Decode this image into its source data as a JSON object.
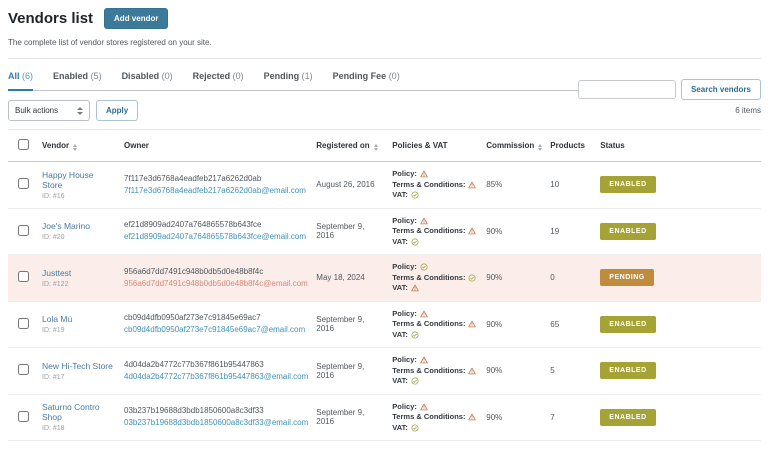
{
  "page": {
    "title": "Vendors list",
    "add_vendor_label": "Add vendor",
    "subtitle": "The complete list of vendor stores registered on your site."
  },
  "tabs": [
    {
      "label": "All",
      "count": "(6)",
      "active": true
    },
    {
      "label": "Enabled",
      "count": "(5)",
      "active": false
    },
    {
      "label": "Disabled",
      "count": "(0)",
      "active": false
    },
    {
      "label": "Rejected",
      "count": "(0)",
      "active": false
    },
    {
      "label": "Pending",
      "count": "(1)",
      "active": false
    },
    {
      "label": "Pending Fee",
      "count": "(0)",
      "active": false
    }
  ],
  "toolbar": {
    "bulk_actions_label": "Bulk actions",
    "apply_label": "Apply",
    "search_value": "",
    "search_button_label": "Search vendors",
    "items_count": "6 items"
  },
  "table": {
    "headers": {
      "vendor": "Vendor",
      "owner": "Owner",
      "registered": "Registered on",
      "policies": "Policies & VAT",
      "commission": "Commission",
      "products": "Products",
      "status": "Status"
    },
    "labels": {
      "policy": "Policy:",
      "terms": "Terms & Conditions:",
      "vat": "VAT:"
    },
    "rows": [
      {
        "vendor": "Happy House Store",
        "id": "ID: #16",
        "owner_name": "7f117e3d6768a4eadfeb217a6262d0ab",
        "owner_email": "7f117e3d6768a4eadfeb217a6262d0ab@email.com",
        "registered": "August 26, 2016",
        "policies": {
          "policy": "warn",
          "terms": "warn",
          "vat": "ok"
        },
        "commission": "85%",
        "products": "10",
        "status": "ENABLED",
        "state": "default"
      },
      {
        "vendor": "Joe's Marino",
        "id": "ID: #20",
        "owner_name": "ef21d8909ad2407a764865578b643fce",
        "owner_email": "ef21d8909ad2407a764865578b643fce@email.com",
        "registered": "September 9, 2016",
        "policies": {
          "policy": "warn",
          "terms": "warn",
          "vat": "ok"
        },
        "commission": "90%",
        "products": "19",
        "status": "ENABLED",
        "state": "default"
      },
      {
        "vendor": "Justtest",
        "id": "ID: #122",
        "owner_name": "956a6d7dd7491c948b0db5d0e48b8f4c",
        "owner_email": "956a6d7dd7491c948b0db5d0e48b8f4c@email.com",
        "registered": "May 18, 2024",
        "policies": {
          "policy": "ok",
          "terms": "ok",
          "vat": "warn"
        },
        "commission": "90%",
        "products": "0",
        "status": "PENDING",
        "state": "pending"
      },
      {
        "vendor": "Lola Mú",
        "id": "ID: #19",
        "owner_name": "cb09d4dfb0950af273e7c91845e69ac7",
        "owner_email": "cb09d4dfb0950af273e7c91845e69ac7@email.com",
        "registered": "September 9, 2016",
        "policies": {
          "policy": "warn",
          "terms": "warn",
          "vat": "ok"
        },
        "commission": "90%",
        "products": "65",
        "status": "ENABLED",
        "state": "default"
      },
      {
        "vendor": "New Hi-Tech Store",
        "id": "ID: #17",
        "owner_name": "4d04da2b4772c77b367f861b95447863",
        "owner_email": "4d04da2b4772c77b367f861b95447863@email.com",
        "registered": "September 9, 2016",
        "policies": {
          "policy": "warn",
          "terms": "warn",
          "vat": "ok"
        },
        "commission": "90%",
        "products": "5",
        "status": "ENABLED",
        "state": "default"
      },
      {
        "vendor": "Saturno Contro Shop",
        "id": "ID: #18",
        "owner_name": "03b237b19688d3bdb1850600a8c3df33",
        "owner_email": "03b237b19688d3bdb1850600a8c3df33@email.com",
        "registered": "September 9, 2016",
        "policies": {
          "policy": "warn",
          "terms": "warn",
          "vat": "ok"
        },
        "commission": "90%",
        "products": "7",
        "status": "ENABLED",
        "state": "default"
      }
    ]
  },
  "colors": {
    "accent_blue": "#2b7cb0",
    "add_button": "#3c7a9a",
    "enabled_badge": "#a5a336",
    "pending_badge": "#bf8c3d",
    "warning_icon": "#c06a3d",
    "ok_icon": "#9ca339",
    "pending_row_bg": "#fbeeea"
  }
}
